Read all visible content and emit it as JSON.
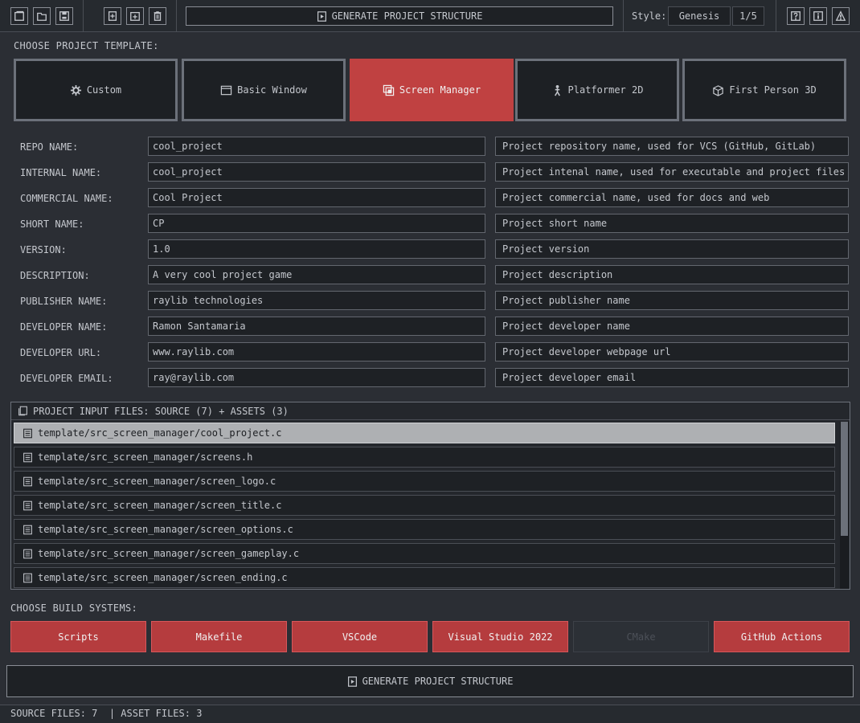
{
  "toolbar": {
    "generate_label": "GENERATE PROJECT STRUCTURE",
    "style_label": "Style:",
    "style_value": "Genesis",
    "style_page": "1/5"
  },
  "templates": {
    "title": "CHOOSE PROJECT TEMPLATE:",
    "items": [
      {
        "label": "Custom",
        "icon": "gear-icon"
      },
      {
        "label": "Basic Window",
        "icon": "window-icon"
      },
      {
        "label": "Screen Manager",
        "icon": "screens-icon",
        "active": true
      },
      {
        "label": "Platformer 2D",
        "icon": "player-icon"
      },
      {
        "label": "First Person 3D",
        "icon": "cube-icon"
      }
    ]
  },
  "form": {
    "rows": [
      {
        "label": "REPO NAME:",
        "value": "cool_project",
        "desc": "Project repository name, used for VCS (GitHub, GitLab)"
      },
      {
        "label": "INTERNAL NAME:",
        "value": "cool_project",
        "desc": "Project intenal name, used for executable and project files"
      },
      {
        "label": "COMMERCIAL NAME:",
        "value": "Cool Project",
        "desc": "Project commercial name, used for docs and web"
      },
      {
        "label": "SHORT NAME:",
        "value": "CP",
        "desc": "Project short name"
      },
      {
        "label": "VERSION:",
        "value": "1.0",
        "desc": "Project version"
      },
      {
        "label": "DESCRIPTION:",
        "value": "A very cool project game",
        "desc": "Project description"
      },
      {
        "label": "PUBLISHER NAME:",
        "value": "raylib technologies",
        "desc": "Project publisher name"
      },
      {
        "label": "DEVELOPER NAME:",
        "value": "Ramon Santamaria",
        "desc": "Project developer name"
      },
      {
        "label": "DEVELOPER URL:",
        "value": "www.raylib.com",
        "desc": "Project developer webpage url"
      },
      {
        "label": "DEVELOPER EMAIL:",
        "value": "ray@raylib.com",
        "desc": "Project developer email"
      }
    ]
  },
  "files": {
    "header": "PROJECT INPUT FILES: SOURCE (7) + ASSETS (3)",
    "items": [
      "template/src_screen_manager/cool_project.c",
      "template/src_screen_manager/screens.h",
      "template/src_screen_manager/screen_logo.c",
      "template/src_screen_manager/screen_title.c",
      "template/src_screen_manager/screen_options.c",
      "template/src_screen_manager/screen_gameplay.c",
      "template/src_screen_manager/screen_ending.c"
    ],
    "selected_index": 0
  },
  "build": {
    "title": "CHOOSE BUILD SYSTEMS:",
    "items": [
      {
        "label": "Scripts",
        "enabled": true
      },
      {
        "label": "Makefile",
        "enabled": true
      },
      {
        "label": "VSCode",
        "enabled": true
      },
      {
        "label": "Visual Studio 2022",
        "enabled": true
      },
      {
        "label": "CMake",
        "enabled": false
      },
      {
        "label": "GitHub Actions",
        "enabled": true
      }
    ]
  },
  "generate_bottom": "GENERATE PROJECT STRUCTURE",
  "status": "SOURCE FILES: 7  | ASSET FILES: 3",
  "colors": {
    "background": "#2b2e34",
    "accent_red": "#c04141",
    "panel": "#1e2125",
    "border": "#6c717a",
    "selected_row": "#aeb0b3"
  }
}
